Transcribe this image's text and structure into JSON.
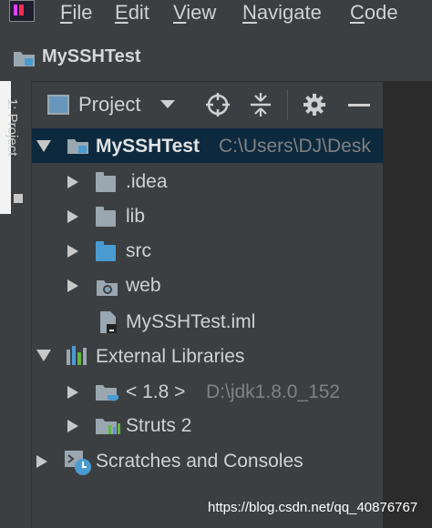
{
  "menu": {
    "items": [
      {
        "accel": "F",
        "rest": "ile"
      },
      {
        "accel": "E",
        "rest": "dit"
      },
      {
        "accel": "V",
        "rest": "iew"
      },
      {
        "accel": "N",
        "rest": "avigate"
      },
      {
        "accel": "C",
        "rest": "ode"
      }
    ]
  },
  "navbar": {
    "project_name": "MySSHTest",
    "icon": "project-folder-icon"
  },
  "side_stripe": {
    "label": "1: Project"
  },
  "tool_window": {
    "title": "Project",
    "icons": [
      "locate-icon",
      "collapse-all-icon",
      "gear-icon",
      "minimize-icon"
    ]
  },
  "tree": {
    "root": {
      "name": "MySSHTest",
      "path": "C:\\Users\\DJ\\Desk"
    },
    "children": [
      {
        "name": ".idea",
        "icon": "folder-icon"
      },
      {
        "name": "lib",
        "icon": "folder-icon"
      },
      {
        "name": "src",
        "icon": "source-folder-icon"
      },
      {
        "name": "web",
        "icon": "web-folder-icon"
      },
      {
        "name": "MySSHTest.iml",
        "icon": "iml-file-icon"
      }
    ],
    "external": {
      "name": "External Libraries",
      "children": [
        {
          "name": "< 1.8 >",
          "path": "D:\\jdk1.8.0_152"
        },
        {
          "name": "Struts 2"
        }
      ]
    },
    "scratches": {
      "name": "Scratches and Consoles"
    }
  },
  "watermark": "https://blog.csdn.net/qq_40876767",
  "colors": {
    "background": "#3c3f41",
    "selection": "#0d293e",
    "editor": "#2b2b2b",
    "source_blue": "#4a9bd1"
  }
}
